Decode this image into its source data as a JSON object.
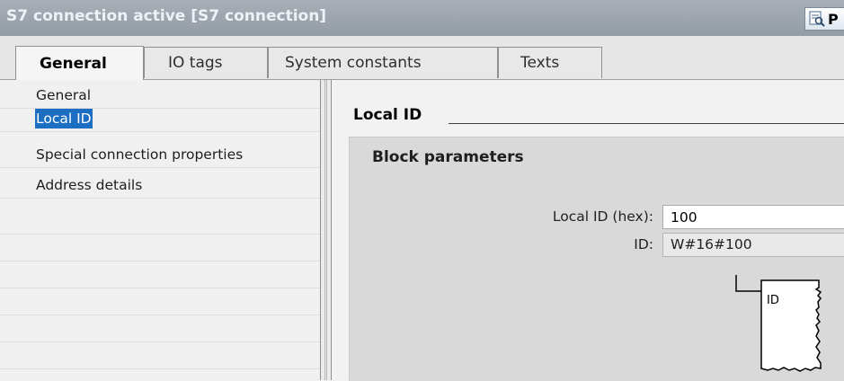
{
  "window": {
    "title": "S7 connection active [S7 connection]",
    "properties_button_label": "P"
  },
  "tabs": [
    {
      "label": "General",
      "active": true
    },
    {
      "label": "IO tags",
      "active": false
    },
    {
      "label": "System constants",
      "active": false
    },
    {
      "label": "Texts",
      "active": false
    }
  ],
  "nav": {
    "items": [
      {
        "label": "General",
        "selected": false
      },
      {
        "label": "Local ID",
        "selected": true
      },
      {
        "label": "Special connection properties",
        "selected": false
      },
      {
        "label": "Address details",
        "selected": false
      }
    ]
  },
  "content": {
    "section_title": "Local ID",
    "panel": {
      "title": "Block parameters",
      "local_id_label": "Local ID (hex):",
      "local_id_value": "100",
      "id_label": "ID:",
      "id_value": "W#16#100",
      "block_pin_label": "ID"
    }
  },
  "colors": {
    "titlebar": "#9ca3ab",
    "selection": "#1b6ec2",
    "panel": "#d9d9d9"
  }
}
